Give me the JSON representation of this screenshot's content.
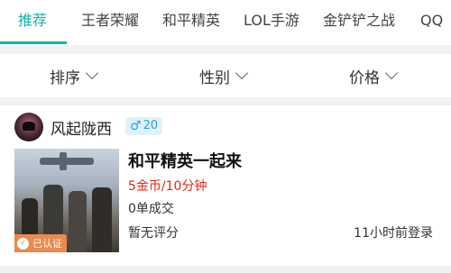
{
  "tabs": [
    {
      "label": "推荐",
      "active": true
    },
    {
      "label": "王者荣耀",
      "active": false
    },
    {
      "label": "和平精英",
      "active": false
    },
    {
      "label": "LOL手游",
      "active": false
    },
    {
      "label": "金铲铲之战",
      "active": false
    },
    {
      "label": "QQ",
      "active": false
    }
  ],
  "filters": [
    {
      "label": "排序",
      "icon": "chevron-down-icon"
    },
    {
      "label": "性别",
      "icon": "chevron-down-icon"
    },
    {
      "label": "价格",
      "icon": "chevron-down-icon"
    }
  ],
  "listing": {
    "username": "风起陇西",
    "gender_symbol": "♂",
    "age": "20",
    "verified_label": "已认证",
    "title": "和平精英一起来",
    "price": "5金币/10分钟",
    "orders": "0单成交",
    "rating": "暂无评分",
    "last_login": "11小时前登录"
  },
  "colors": {
    "accent": "#13b5a5",
    "price": "#e0271a",
    "gender_badge_bg": "#dff2fb",
    "gender_badge_fg": "#2a9fe0",
    "verified_bg": "#e98a4e"
  }
}
